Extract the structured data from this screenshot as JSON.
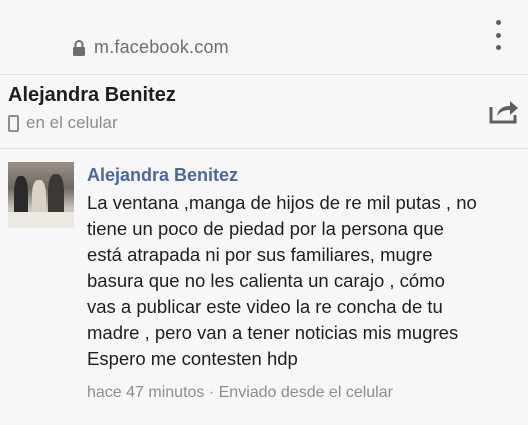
{
  "browser": {
    "url": "m.facebook.com"
  },
  "header": {
    "name": "Alejandra Benitez",
    "sub": "en el celular"
  },
  "post": {
    "author": "Alejandra Benitez",
    "lines": [
      "La ventana ,manga de hijos de re mil putas , no",
      "tiene un poco de piedad por la persona que",
      "está atrapada ni por sus familiares, mugre",
      "basura que no les calienta un carajo , cómo",
      "vas a publicar este video la re concha de tu",
      "madre , pero van a tener noticias mis mugres",
      "Espero me contesten hdp"
    ],
    "meta": "hace 47 minutos · Enviado desde el celular"
  },
  "icons": {
    "lock": "lock-icon",
    "menu": "more-vertical-icon",
    "phone": "mobile-phone-icon",
    "share": "share-icon"
  }
}
